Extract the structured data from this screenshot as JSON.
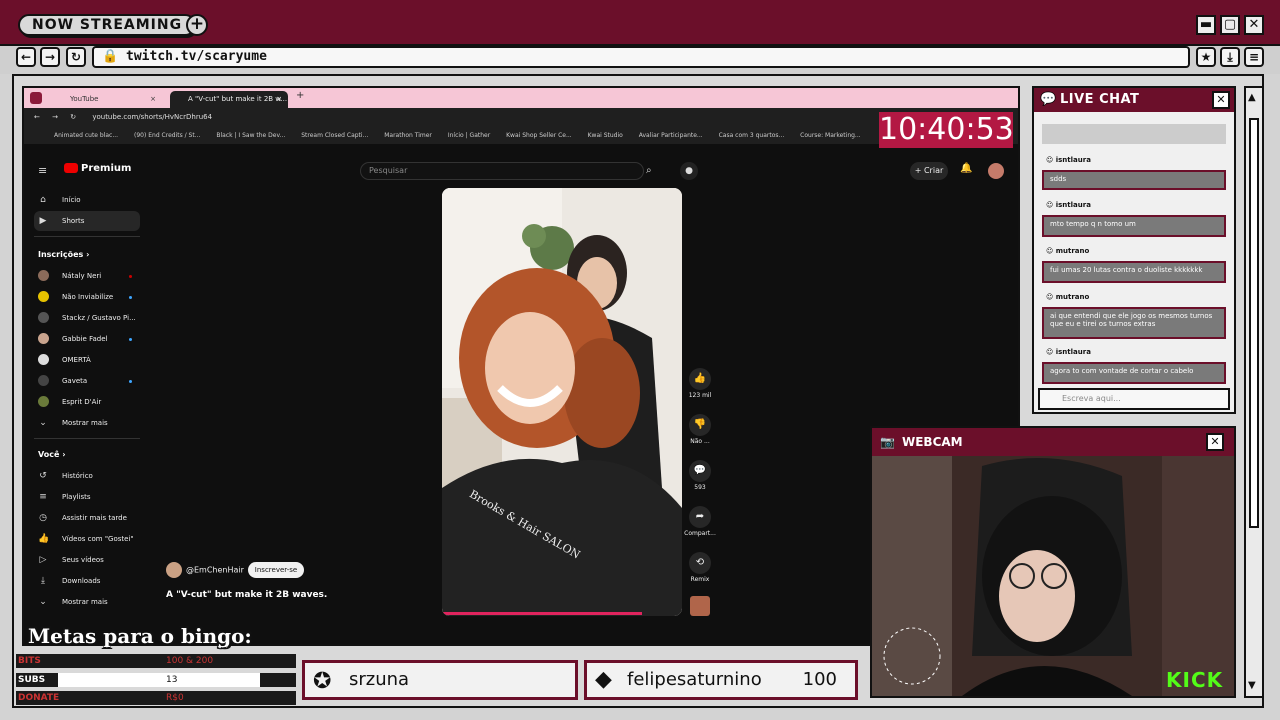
{
  "overlay": {
    "title": "NOW STREAMING",
    "plus": "+",
    "url": "twitch.tv/scaryume",
    "min": "▬",
    "max": "▢",
    "close": "✕"
  },
  "browser": {
    "tabs": [
      {
        "label": "YouTube"
      },
      {
        "label": "A \"V-cut\" but make it 2B w..."
      }
    ],
    "new_tab": "+",
    "address": "youtube.com/shorts/HvNcrDhru64",
    "bookmarks": [
      "Animated cute blac...",
      "(90) End Credits / St...",
      "Black | I Saw the Dev...",
      "Stream Closed Capti...",
      "Marathon Timer",
      "Início | Gather",
      "Kwai Shop Seller Ce...",
      "Kwai Studio",
      "Avaliar Participante...",
      "Casa com 3 quartos...",
      "Course: Marketing..."
    ],
    "clock": "10:40:53"
  },
  "youtube": {
    "logo": "Premium",
    "search_placeholder": "Pesquisar",
    "create": "+ Criar",
    "nav": [
      {
        "label": "Início",
        "icon": "⌂"
      },
      {
        "label": "Shorts",
        "icon": "▶"
      }
    ],
    "subs_heading": "Inscrições  ›",
    "subs": [
      {
        "label": "Nátaly Neri",
        "color": "#8b6b5a",
        "live": true
      },
      {
        "label": "Não Inviabilize",
        "color": "#e6c200",
        "dot": true
      },
      {
        "label": "Stackz / Gustavo Pi...",
        "color": "#555555"
      },
      {
        "label": "Gabbie Fadel",
        "color": "#c9a48e",
        "dot": true
      },
      {
        "label": "OMERTÀ",
        "color": "#dddddd"
      },
      {
        "label": "Gaveta",
        "color": "#444444",
        "dot": true
      },
      {
        "label": "Esprit D'Air",
        "color": "#6a7a3a"
      },
      {
        "label": "Mostrar mais",
        "icon": "⌄"
      }
    ],
    "you_heading": "Você  ›",
    "you": [
      {
        "label": "Histórico",
        "icon": "↺"
      },
      {
        "label": "Playlists",
        "icon": "≡"
      },
      {
        "label": "Assistir mais tarde",
        "icon": "◷"
      },
      {
        "label": "Vídeos com \"Gostei\"",
        "icon": "👍"
      },
      {
        "label": "Seus vídeos",
        "icon": "▷"
      },
      {
        "label": "Downloads",
        "icon": "⤓"
      },
      {
        "label": "Mostrar mais",
        "icon": "⌄"
      }
    ],
    "actions": [
      {
        "icon": "👍",
        "label": "123 mil"
      },
      {
        "icon": "👎",
        "label": "Não ..."
      },
      {
        "icon": "💬",
        "label": "593"
      },
      {
        "icon": "➦",
        "label": "Compart..."
      },
      {
        "icon": "⟲",
        "label": "Remix"
      }
    ],
    "channel": "@EmChenHair",
    "subscribe": "Inscrever-se",
    "short_title": "A \"V-cut\" but make it 2B waves.",
    "shirt_text": "Brooks & Hair SALON"
  },
  "chat": {
    "title": "LIVE CHAT",
    "messages": [
      {
        "user": "isntlaura",
        "text": "sdds"
      },
      {
        "user": "isntlaura",
        "text": "mto tempo q n tomo um"
      },
      {
        "user": "mutrano",
        "text": "fui umas 20 lutas contra o duoliste kkkkkkk"
      },
      {
        "user": "mutrano",
        "text": "ai que entendi que ele jogo os mesmos turnos que eu e tirei os turnos extras"
      },
      {
        "user": "isntlaura",
        "text": "agora to com vontade de cortar o cabelo"
      }
    ],
    "input_placeholder": "Escreva aqui..."
  },
  "webcam": {
    "title": "WEBCAM",
    "brand": "KICK"
  },
  "goals": {
    "title": "Metas para o bingo:",
    "rows": [
      {
        "label": "BITS",
        "value": "100 & 200"
      },
      {
        "label": "SUBS",
        "value": "13",
        "progress": 0.85
      },
      {
        "label": "DONATE",
        "value": "R$0"
      }
    ]
  },
  "banners": [
    {
      "name": "srzuna",
      "value": ""
    },
    {
      "name": "felipesaturnino",
      "value": "100"
    }
  ],
  "colors": {
    "accent": "#6b0f2a",
    "clock_bg": "#b31843",
    "kick": "#53fc18"
  }
}
